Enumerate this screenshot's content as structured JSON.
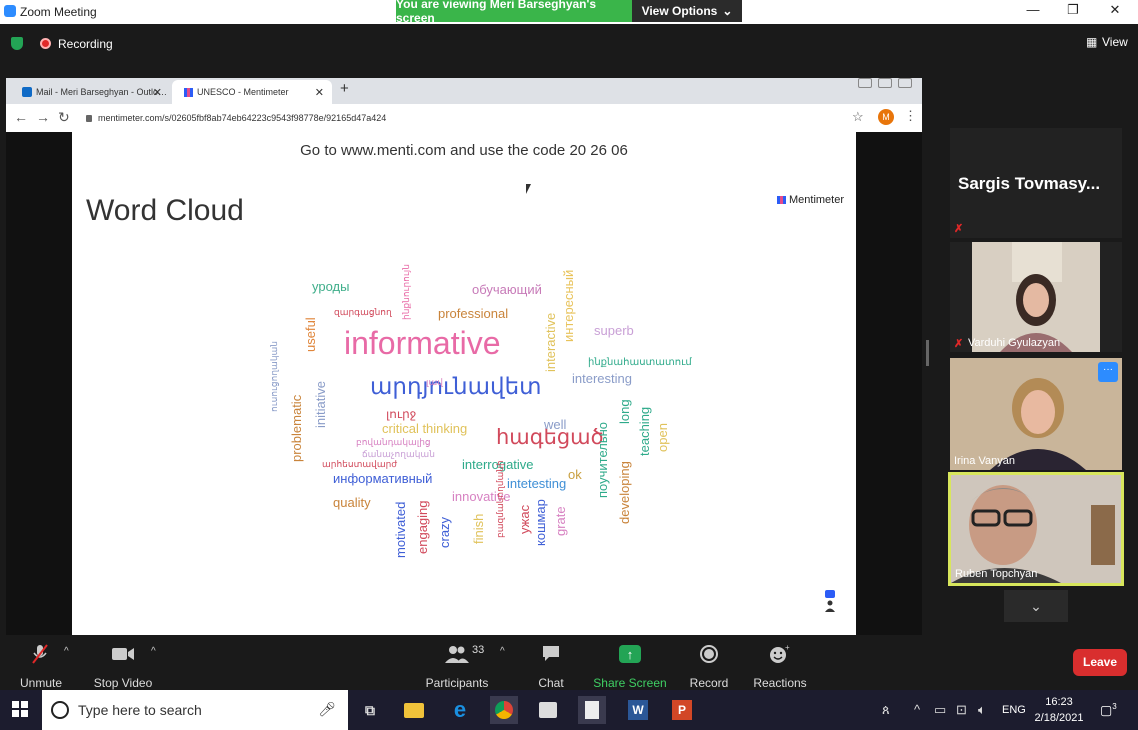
{
  "window": {
    "title": "Zoom Meeting",
    "viewing_banner": "You are viewing Meri Barseghyan's screen",
    "view_options": "View Options",
    "minimize": "—",
    "restore": "❐",
    "close": "✕"
  },
  "topbar": {
    "recording": "Recording",
    "view": "View"
  },
  "browser": {
    "tabs": [
      {
        "label": "Mail - Meri Barseghyan - Outlo…"
      },
      {
        "label": "UNESCO - Mentimeter"
      }
    ],
    "new_tab": "+",
    "url": "mentimeter.com/s/02605fbf8ab74eb64223c9543f98778e/92165d47a424",
    "avatar_letter": "M"
  },
  "slide": {
    "join_text": "Go to www.menti.com and use the code 20 26 06",
    "title": "Word Cloud",
    "brand": "Mentimeter",
    "words": [
      {
        "text": "informative",
        "color": "#e86aa6"
      },
      {
        "text": "արդյունավետ",
        "color": "#3f5fd6"
      },
      {
        "text": "հագեցած",
        "color": "#d1495b"
      },
      {
        "text": "professional",
        "color": "#c9843b"
      },
      {
        "text": "обучающий",
        "color": "#c77ab8"
      },
      {
        "text": "уроды",
        "color": "#3fae8a"
      },
      {
        "text": "interesting",
        "color": "#8a9cc8"
      },
      {
        "text": "superb",
        "color": "#c9a0d6"
      },
      {
        "text": "interactive",
        "color": "#e0c25a"
      },
      {
        "text": "интересный",
        "color": "#e8c35b"
      },
      {
        "text": "critical thinking",
        "color": "#e0c25a"
      },
      {
        "text": "interrogative",
        "color": "#2eaa8a"
      },
      {
        "text": "информативный",
        "color": "#3f5fd6"
      },
      {
        "text": "intetesting",
        "color": "#3f8fd6"
      },
      {
        "text": "innovative",
        "color": "#d782c2"
      },
      {
        "text": "quality",
        "color": "#c9843b"
      },
      {
        "text": "well",
        "color": "#8a9cc8"
      },
      {
        "text": "ok",
        "color": "#c9a040"
      },
      {
        "text": "useful",
        "color": "#e0863b"
      },
      {
        "text": "initiative",
        "color": "#8a9cc8"
      },
      {
        "text": "problematic",
        "color": "#c9843b"
      },
      {
        "text": "motivated",
        "color": "#3f5fd6"
      },
      {
        "text": "engaging",
        "color": "#d1495b"
      },
      {
        "text": "crazy",
        "color": "#3f5fd6"
      },
      {
        "text": "finish",
        "color": "#e0c25a"
      },
      {
        "text": "ужас",
        "color": "#d1495b"
      },
      {
        "text": "кошмар",
        "color": "#3f5fd6"
      },
      {
        "text": "grate",
        "color": "#d782c2"
      },
      {
        "text": "developing",
        "color": "#c9843b"
      },
      {
        "text": "поучительно",
        "color": "#2eaa8a"
      },
      {
        "text": "long",
        "color": "#2eaa8a"
      },
      {
        "text": "teaching",
        "color": "#2eaa8a"
      },
      {
        "text": "open",
        "color": "#e0c25a"
      },
      {
        "text": "ինքնահաստատում",
        "color": "#2eaa8a"
      },
      {
        "text": "բովանդակալից",
        "color": "#d782c2"
      },
      {
        "text": "ճանաչողական",
        "color": "#c9a0d6"
      },
      {
        "text": "արհեստավարժ",
        "color": "#d1495b"
      },
      {
        "text": "զարգացնող",
        "color": "#d1495b"
      },
      {
        "text": "ինքնուրույն",
        "color": "#e86aa6"
      },
      {
        "text": "ուսուցողական",
        "color": "#8a9cc8"
      },
      {
        "text": "բազմակողմանի",
        "color": "#d1495b"
      },
      {
        "text": "լավ",
        "color": "#d782c2"
      },
      {
        "text": "լուրջ",
        "color": "#d1495b"
      }
    ]
  },
  "participants": [
    {
      "name": "Sargis  Tovmasy..."
    },
    {
      "name": "Varduhi Gyulazyan"
    },
    {
      "name": "Irina Vanyan"
    },
    {
      "name": "Ruben Topchyan"
    }
  ],
  "toolbar": {
    "unmute": "Unmute",
    "stop_video": "Stop Video",
    "participants": "Participants",
    "participants_count": "33",
    "chat": "Chat",
    "share_screen": "Share Screen",
    "record": "Record",
    "reactions": "Reactions",
    "leave": "Leave"
  },
  "taskbar": {
    "search_placeholder": "Type here to search",
    "lang": "ENG",
    "time": "16:23",
    "date": "2/18/2021",
    "notifications": "3"
  }
}
